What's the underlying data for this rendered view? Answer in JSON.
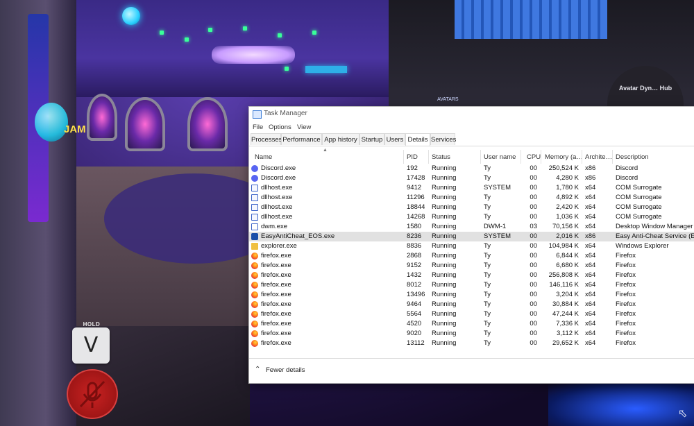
{
  "background": {
    "sign": "JAM",
    "hud_hold": "HOLD",
    "hud_key": "V",
    "dome_label": "Avatar Dyn… Hub",
    "avatars_label": "AVATARS"
  },
  "window": {
    "title": "Task Manager"
  },
  "menu": [
    "File",
    "Options",
    "View"
  ],
  "tabs": [
    {
      "label": "Processes",
      "active": false
    },
    {
      "label": "Performance",
      "active": false
    },
    {
      "label": "App history",
      "active": false
    },
    {
      "label": "Startup",
      "active": false
    },
    {
      "label": "Users",
      "active": false
    },
    {
      "label": "Details",
      "active": true
    },
    {
      "label": "Services",
      "active": false
    }
  ],
  "columns": {
    "name": "Name",
    "pid": "PID",
    "status": "Status",
    "user": "User name",
    "cpu": "CPU",
    "memory": "Memory (a…",
    "arch": "Archite…",
    "description": "Description"
  },
  "rows": [
    {
      "icon": "discord",
      "name": "Discord.exe",
      "pid": "192",
      "status": "Running",
      "user": "Ty",
      "cpu": "00",
      "memory": "250,524 K",
      "arch": "x86",
      "description": "Discord"
    },
    {
      "icon": "discord",
      "name": "Discord.exe",
      "pid": "17428",
      "status": "Running",
      "user": "Ty",
      "cpu": "00",
      "memory": "4,280 K",
      "arch": "x86",
      "description": "Discord"
    },
    {
      "icon": "host",
      "name": "dllhost.exe",
      "pid": "9412",
      "status": "Running",
      "user": "SYSTEM",
      "cpu": "00",
      "memory": "1,780 K",
      "arch": "x64",
      "description": "COM Surrogate"
    },
    {
      "icon": "host",
      "name": "dllhost.exe",
      "pid": "11296",
      "status": "Running",
      "user": "Ty",
      "cpu": "00",
      "memory": "4,892 K",
      "arch": "x64",
      "description": "COM Surrogate"
    },
    {
      "icon": "host",
      "name": "dllhost.exe",
      "pid": "18844",
      "status": "Running",
      "user": "Ty",
      "cpu": "00",
      "memory": "2,420 K",
      "arch": "x64",
      "description": "COM Surrogate"
    },
    {
      "icon": "host",
      "name": "dllhost.exe",
      "pid": "14268",
      "status": "Running",
      "user": "Ty",
      "cpu": "00",
      "memory": "1,036 K",
      "arch": "x64",
      "description": "COM Surrogate"
    },
    {
      "icon": "dwm",
      "name": "dwm.exe",
      "pid": "1580",
      "status": "Running",
      "user": "DWM-1",
      "cpu": "03",
      "memory": "70,156 K",
      "arch": "x64",
      "description": "Desktop Window Manager"
    },
    {
      "icon": "eac",
      "name": "EasyAntiCheat_EOS.exe",
      "pid": "8236",
      "status": "Running",
      "user": "SYSTEM",
      "cpu": "00",
      "memory": "2,016 K",
      "arch": "x86",
      "description": "Easy Anti-Cheat Service (EOS)",
      "selected": true
    },
    {
      "icon": "explorer",
      "name": "explorer.exe",
      "pid": "8836",
      "status": "Running",
      "user": "Ty",
      "cpu": "00",
      "memory": "104,984 K",
      "arch": "x64",
      "description": "Windows Explorer"
    },
    {
      "icon": "firefox",
      "name": "firefox.exe",
      "pid": "2868",
      "status": "Running",
      "user": "Ty",
      "cpu": "00",
      "memory": "6,844 K",
      "arch": "x64",
      "description": "Firefox"
    },
    {
      "icon": "firefox",
      "name": "firefox.exe",
      "pid": "9152",
      "status": "Running",
      "user": "Ty",
      "cpu": "00",
      "memory": "6,680 K",
      "arch": "x64",
      "description": "Firefox"
    },
    {
      "icon": "firefox",
      "name": "firefox.exe",
      "pid": "1432",
      "status": "Running",
      "user": "Ty",
      "cpu": "00",
      "memory": "256,808 K",
      "arch": "x64",
      "description": "Firefox"
    },
    {
      "icon": "firefox",
      "name": "firefox.exe",
      "pid": "8012",
      "status": "Running",
      "user": "Ty",
      "cpu": "00",
      "memory": "146,116 K",
      "arch": "x64",
      "description": "Firefox"
    },
    {
      "icon": "firefox",
      "name": "firefox.exe",
      "pid": "13496",
      "status": "Running",
      "user": "Ty",
      "cpu": "00",
      "memory": "3,204 K",
      "arch": "x64",
      "description": "Firefox"
    },
    {
      "icon": "firefox",
      "name": "firefox.exe",
      "pid": "9464",
      "status": "Running",
      "user": "Ty",
      "cpu": "00",
      "memory": "30,884 K",
      "arch": "x64",
      "description": "Firefox"
    },
    {
      "icon": "firefox",
      "name": "firefox.exe",
      "pid": "5564",
      "status": "Running",
      "user": "Ty",
      "cpu": "00",
      "memory": "47,244 K",
      "arch": "x64",
      "description": "Firefox"
    },
    {
      "icon": "firefox",
      "name": "firefox.exe",
      "pid": "4520",
      "status": "Running",
      "user": "Ty",
      "cpu": "00",
      "memory": "7,336 K",
      "arch": "x64",
      "description": "Firefox"
    },
    {
      "icon": "firefox",
      "name": "firefox.exe",
      "pid": "9020",
      "status": "Running",
      "user": "Ty",
      "cpu": "00",
      "memory": "3,112 K",
      "arch": "x64",
      "description": "Firefox"
    },
    {
      "icon": "firefox",
      "name": "firefox.exe",
      "pid": "13112",
      "status": "Running",
      "user": "Ty",
      "cpu": "00",
      "memory": "29,652 K",
      "arch": "x64",
      "description": "Firefox"
    }
  ],
  "footer": {
    "fewer_details": "Fewer details"
  }
}
